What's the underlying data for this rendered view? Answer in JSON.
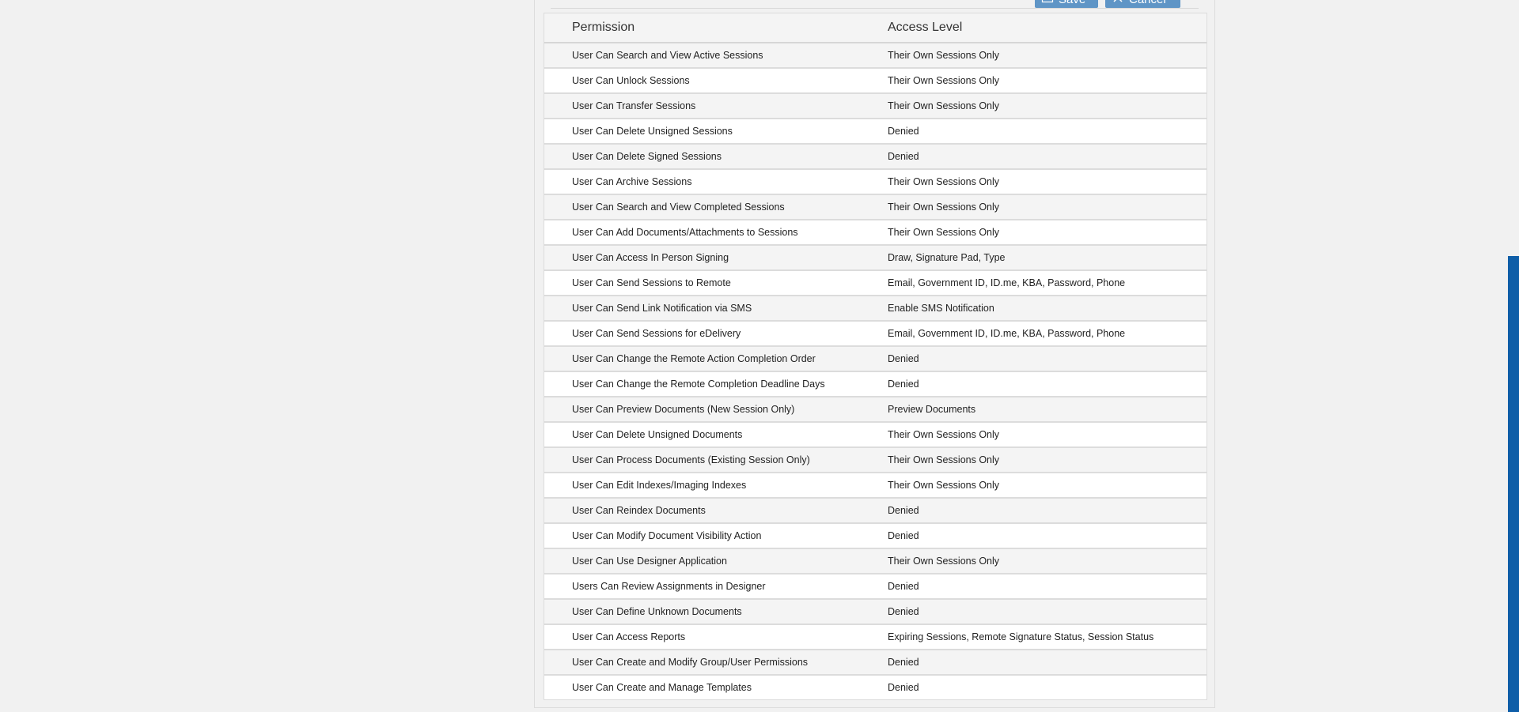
{
  "toolbar": {
    "save_label": "Save",
    "cancel_label": "Cancel"
  },
  "table": {
    "headers": {
      "permission": "Permission",
      "access_level": "Access Level"
    },
    "rows": [
      {
        "permission": "User Can Search and View Active Sessions",
        "access": "Their Own Sessions Only"
      },
      {
        "permission": "User Can Unlock Sessions",
        "access": "Their Own Sessions Only"
      },
      {
        "permission": "User Can Transfer Sessions",
        "access": "Their Own Sessions Only"
      },
      {
        "permission": "User Can Delete Unsigned Sessions",
        "access": "Denied"
      },
      {
        "permission": "User Can Delete Signed Sessions",
        "access": "Denied"
      },
      {
        "permission": "User Can Archive Sessions",
        "access": "Their Own Sessions Only"
      },
      {
        "permission": "User Can Search and View Completed Sessions",
        "access": "Their Own Sessions Only"
      },
      {
        "permission": "User Can Add Documents/Attachments to Sessions",
        "access": "Their Own Sessions Only"
      },
      {
        "permission": "User Can Access In Person Signing",
        "access": "Draw, Signature Pad, Type"
      },
      {
        "permission": "User Can Send Sessions to Remote",
        "access": "Email, Government ID, ID.me, KBA, Password, Phone"
      },
      {
        "permission": "User Can Send Link Notification via SMS",
        "access": "Enable SMS Notification"
      },
      {
        "permission": "User Can Send Sessions for eDelivery",
        "access": "Email, Government ID, ID.me, KBA, Password, Phone"
      },
      {
        "permission": "User Can Change the Remote Action Completion Order",
        "access": "Denied"
      },
      {
        "permission": "User Can Change the Remote Completion Deadline Days",
        "access": "Denied"
      },
      {
        "permission": "User Can Preview Documents (New Session Only)",
        "access": "Preview Documents"
      },
      {
        "permission": "User Can Delete Unsigned Documents",
        "access": "Their Own Sessions Only"
      },
      {
        "permission": "User Can Process Documents (Existing Session Only)",
        "access": "Their Own Sessions Only"
      },
      {
        "permission": "User Can Edit Indexes/Imaging Indexes",
        "access": "Their Own Sessions Only"
      },
      {
        "permission": "User Can Reindex Documents",
        "access": "Denied"
      },
      {
        "permission": "User Can Modify Document Visibility Action",
        "access": "Denied"
      },
      {
        "permission": "User Can Use Designer Application",
        "access": "Their Own Sessions Only"
      },
      {
        "permission": "Users Can Review Assignments in Designer",
        "access": "Denied"
      },
      {
        "permission": "User Can Define Unknown Documents",
        "access": "Denied"
      },
      {
        "permission": "User Can Access Reports",
        "access": "Expiring Sessions, Remote Signature Status, Session Status"
      },
      {
        "permission": "User Can Create and Modify Group/User Permissions",
        "access": "Denied"
      },
      {
        "permission": "User Can Create and Manage Templates",
        "access": "Denied"
      }
    ]
  },
  "icons": {
    "save": "save-icon",
    "cancel": "close-icon"
  },
  "colors": {
    "button": "#5f95c6",
    "scrollbar": "#0f5ea8",
    "row_alt": "#f4f4f4"
  }
}
